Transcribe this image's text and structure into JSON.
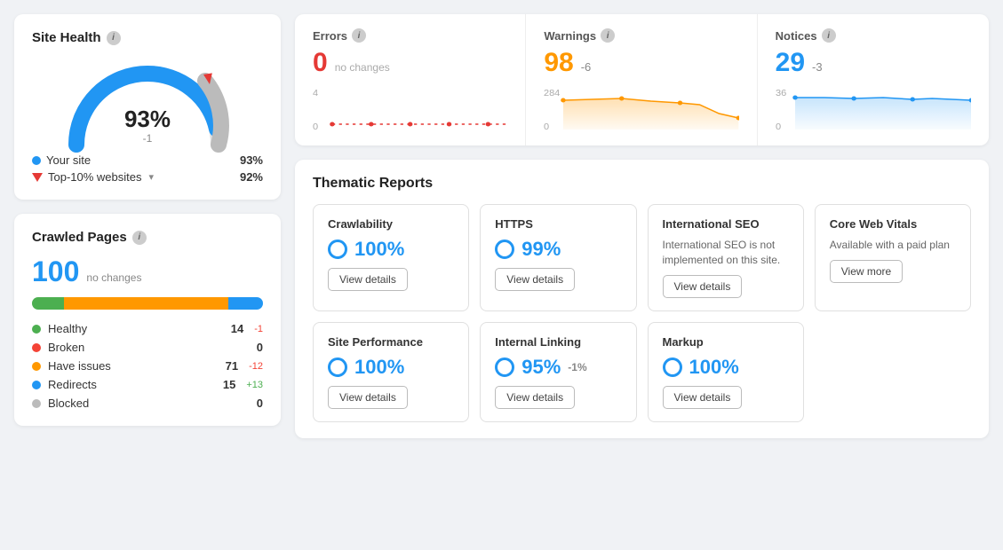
{
  "site_health": {
    "title": "Site Health",
    "percent": "93%",
    "change": "-1",
    "your_site_label": "Your site",
    "your_site_value": "93%",
    "top_label": "Top-10% websites",
    "top_value": "92%"
  },
  "crawled_pages": {
    "title": "Crawled Pages",
    "count": "100",
    "sub": "no changes",
    "items": [
      {
        "label": "Healthy",
        "color": "green",
        "value": "14",
        "change": "-1",
        "change_type": "neg"
      },
      {
        "label": "Broken",
        "color": "red",
        "value": "0",
        "change": "",
        "change_type": ""
      },
      {
        "label": "Have issues",
        "color": "orange",
        "value": "71",
        "change": "-12",
        "change_type": "neg"
      },
      {
        "label": "Redirects",
        "color": "blue",
        "value": "15",
        "change": "+13",
        "change_type": "pos"
      },
      {
        "label": "Blocked",
        "color": "gray",
        "value": "0",
        "change": "",
        "change_type": ""
      }
    ]
  },
  "metrics": {
    "errors": {
      "label": "Errors",
      "value": "0",
      "change": "no changes",
      "y_max": "4",
      "y_min": "0"
    },
    "warnings": {
      "label": "Warnings",
      "value": "98",
      "change": "-6",
      "y_max": "284",
      "y_min": "0"
    },
    "notices": {
      "label": "Notices",
      "value": "29",
      "change": "-3",
      "y_max": "36",
      "y_min": "0"
    }
  },
  "thematic_reports": {
    "title": "Thematic Reports",
    "row1": [
      {
        "name": "Crawlability",
        "score": "100%",
        "change": "",
        "has_score": true,
        "desc": "",
        "btn": "View details"
      },
      {
        "name": "HTTPS",
        "score": "99%",
        "change": "",
        "has_score": true,
        "desc": "",
        "btn": "View details"
      },
      {
        "name": "International SEO",
        "score": "",
        "change": "",
        "has_score": false,
        "desc": "International SEO is not implemented on this site.",
        "btn": "View details"
      },
      {
        "name": "Core Web Vitals",
        "score": "",
        "change": "",
        "has_score": false,
        "desc": "Available with a paid plan",
        "btn": "View more"
      }
    ],
    "row2": [
      {
        "name": "Site Performance",
        "score": "100%",
        "change": "",
        "has_score": true,
        "desc": "",
        "btn": "View details"
      },
      {
        "name": "Internal Linking",
        "score": "95%",
        "change": "-1%",
        "has_score": true,
        "desc": "",
        "btn": "View details"
      },
      {
        "name": "Markup",
        "score": "100%",
        "change": "",
        "has_score": true,
        "desc": "",
        "btn": "View details"
      }
    ]
  }
}
